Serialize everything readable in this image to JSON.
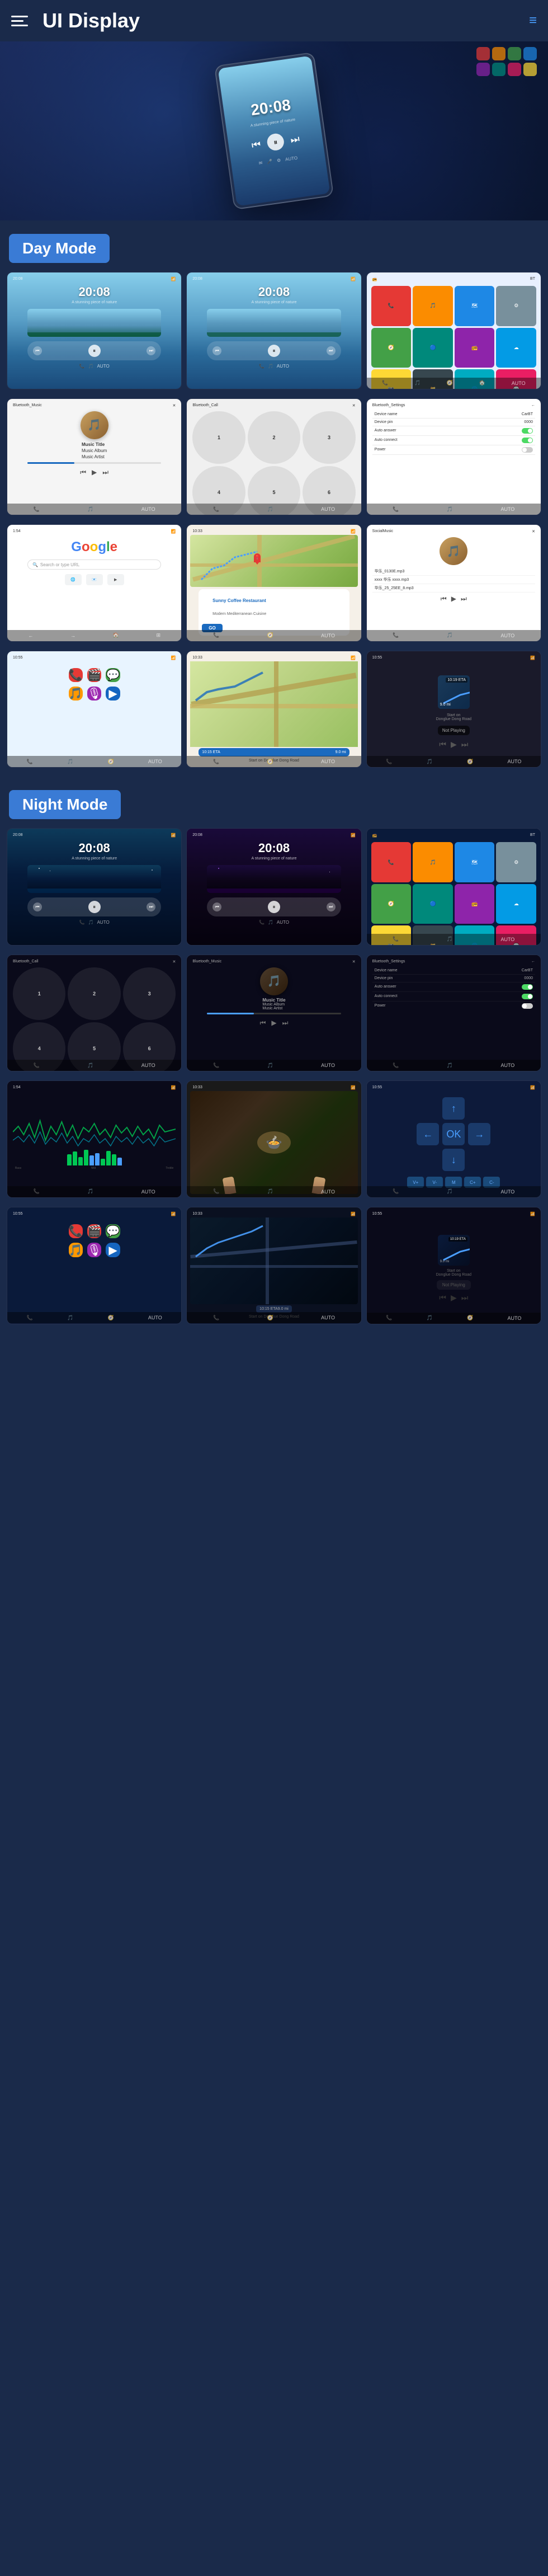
{
  "header": {
    "title": "UI Display",
    "menu_label": "menu",
    "nav_label": "navigation"
  },
  "sections": {
    "day_mode": "Day Mode",
    "night_mode": "Night Mode"
  },
  "hero": {
    "time": "20:08",
    "subtitle": "A stunning piece of nature"
  },
  "day_screens": {
    "music1": {
      "time": "20:08",
      "sub": "A stunning piece of nature"
    },
    "music2": {
      "time": "20:08",
      "sub": "A stunning piece of nature"
    }
  },
  "music_info": {
    "title": "Music Title",
    "album": "Music Album",
    "artist": "Music Artist"
  },
  "call": {
    "label": "Bluetooth_Call"
  },
  "settings": {
    "label": "Bluetooth_Settings",
    "items": [
      {
        "name": "Device name",
        "value": "CarBT"
      },
      {
        "name": "Device pin",
        "value": "0000"
      },
      {
        "name": "Auto answer",
        "value": "toggle-on"
      },
      {
        "name": "Auto connect",
        "value": "toggle-on"
      },
      {
        "name": "Power",
        "value": "toggle-off"
      }
    ]
  },
  "google": {
    "label": "Google",
    "search_placeholder": "Search or type URL"
  },
  "navigation": {
    "restaurant": "Sunny Coffee Restaurant",
    "address": "Modern Mediterranean Cuisine",
    "go_label": "GO",
    "eta": "10:15 ETA",
    "distance": "9.0 mi"
  },
  "social_music": {
    "label": "SocialMusic",
    "songs": [
      "华乐_0130E.mp3",
      "xxxx 华乐 xxxx.mp3",
      "华乐_25_25EE_8.mp3"
    ]
  },
  "night_mode_label": "Night Mode",
  "night": {
    "time": "20:08",
    "music_title": "Music Title",
    "music_album": "Music Album",
    "music_artist": "Music Artist"
  },
  "colors": {
    "accent": "#3a7bd5",
    "background": "#1a2a4a",
    "day_bg1": "#87ceeb",
    "night_bg1": "#0d3a5a"
  }
}
